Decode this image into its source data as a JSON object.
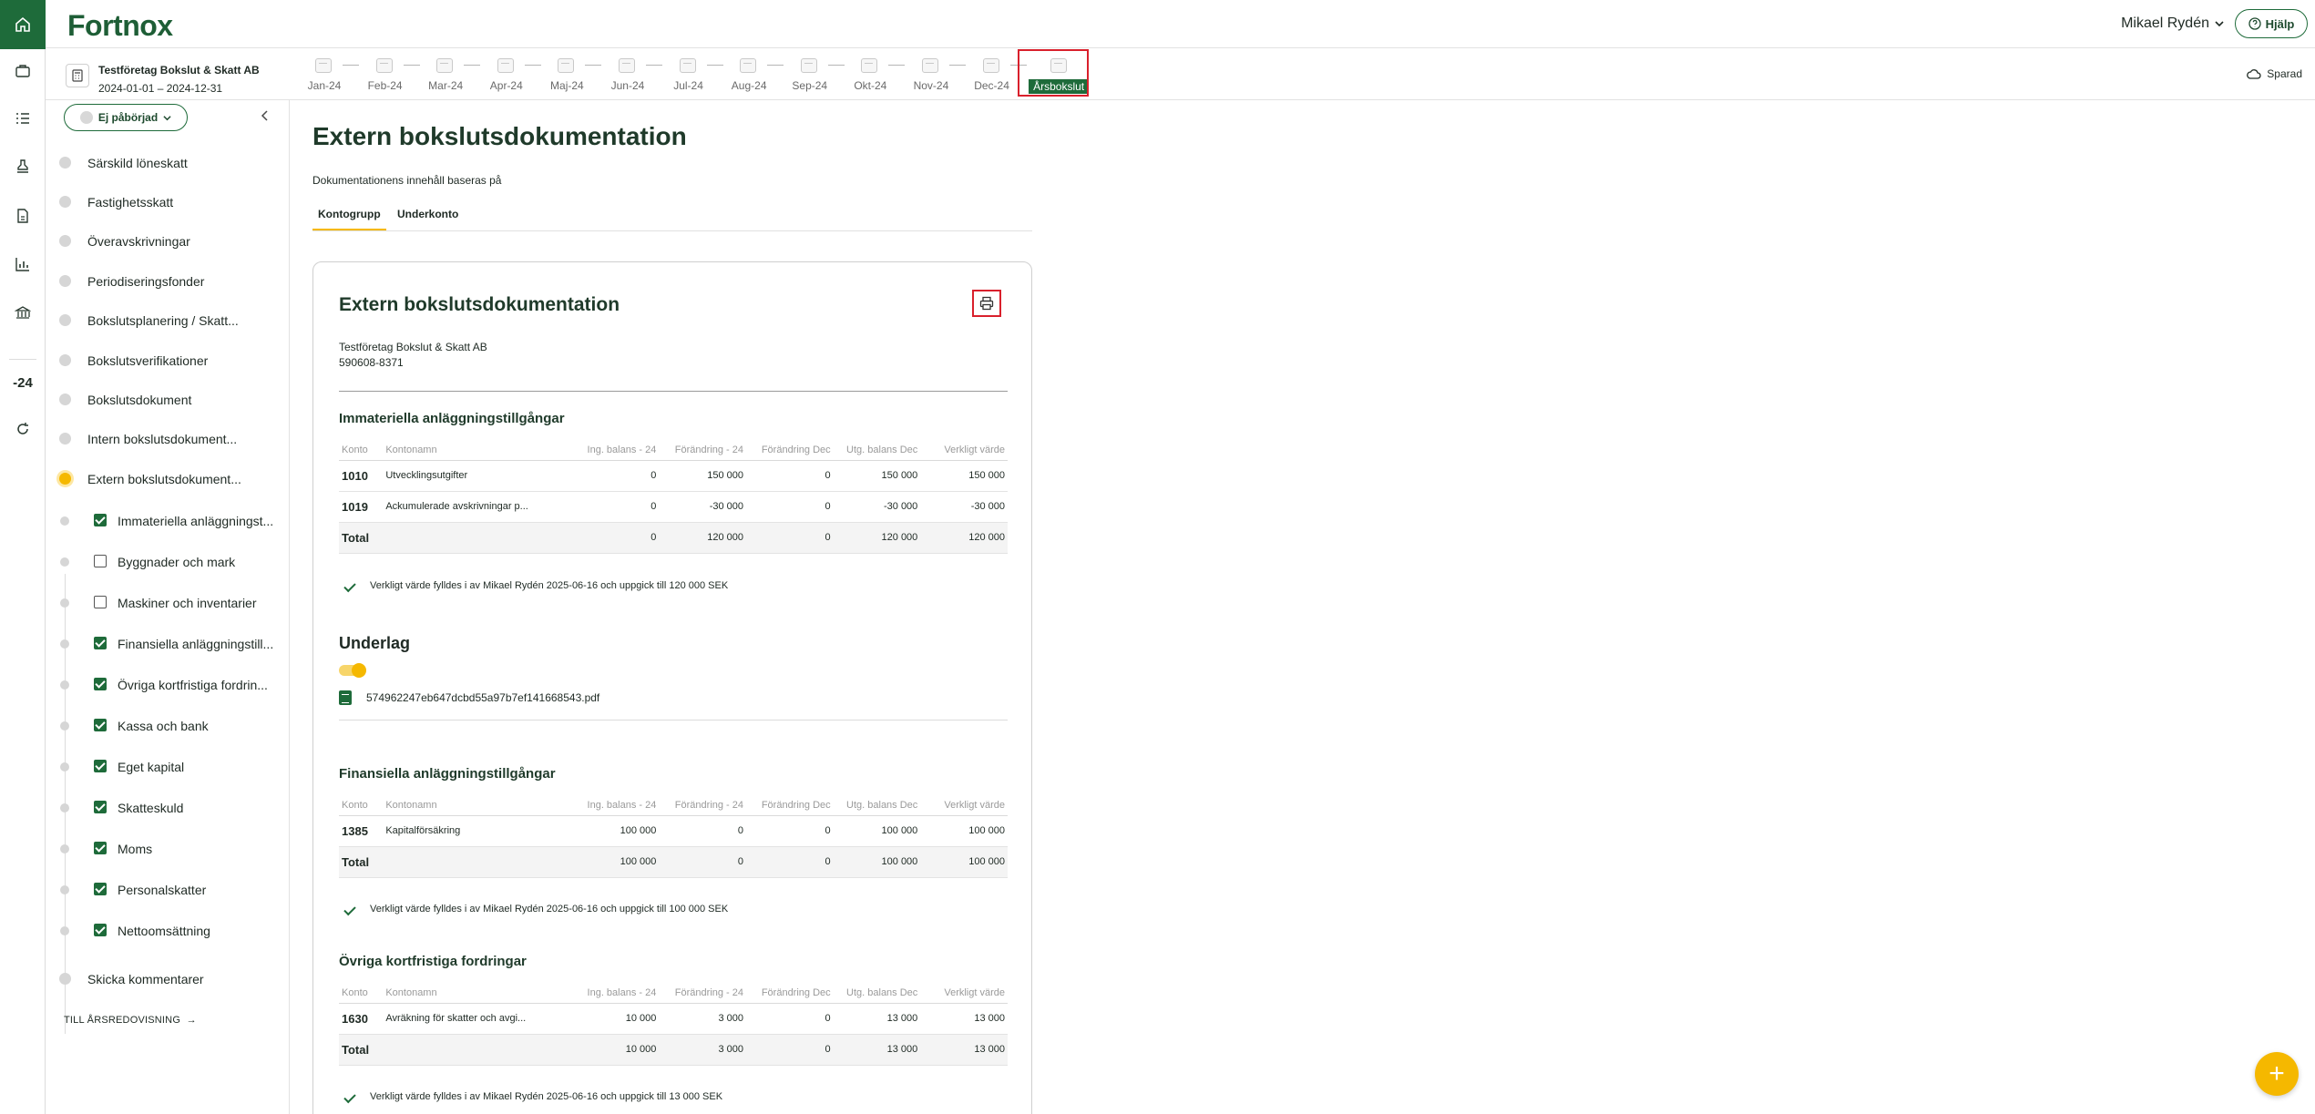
{
  "brand": "Fortnox",
  "header": {
    "user_name": "Mikael Rydén",
    "help_label": "Hjälp",
    "saved_label": "Sparad"
  },
  "rail": {
    "year_label": "-24"
  },
  "company": {
    "name": "Testföretag Bokslut & Skatt AB",
    "period": "2024-01-01 – 2024-12-31"
  },
  "months": [
    "Jan-24",
    "Feb-24",
    "Mar-24",
    "Apr-24",
    "Maj-24",
    "Jun-24",
    "Jul-24",
    "Aug-24",
    "Sep-24",
    "Okt-24",
    "Nov-24",
    "Dec-24",
    "Årsbokslut"
  ],
  "sidebar": {
    "status": "Ej påbörjad",
    "items": [
      "Särskild löneskatt",
      "Fastighetsskatt",
      "Överavskrivningar",
      "Periodiseringsfonder",
      "Bokslutsplanering / Skatt...",
      "Bokslutsverifikationer",
      "Bokslutsdokument",
      "Intern bokslutsdokument...",
      "Extern bokslutsdokument..."
    ],
    "subitems": [
      {
        "label": "Immateriella anläggningst...",
        "checked": true
      },
      {
        "label": "Byggnader och mark",
        "checked": false
      },
      {
        "label": "Maskiner och inventarier",
        "checked": false
      },
      {
        "label": "Finansiella anläggningstill...",
        "checked": true
      },
      {
        "label": "Övriga kortfristiga fordrin...",
        "checked": true
      },
      {
        "label": "Kassa och bank",
        "checked": true
      },
      {
        "label": "Eget kapital",
        "checked": true
      },
      {
        "label": "Skatteskuld",
        "checked": true
      },
      {
        "label": "Moms",
        "checked": true
      },
      {
        "label": "Personalskatter",
        "checked": true
      },
      {
        "label": "Nettoomsättning",
        "checked": true
      }
    ],
    "last_item": "Skicka kommentarer",
    "to_report": "TILL ÅRSREDOVISNING"
  },
  "main": {
    "title": "Extern bokslutsdokumentation",
    "based_on": "Dokumentationens innehåll baseras på",
    "tabs": [
      "Kontogrupp",
      "Underkonto"
    ],
    "card": {
      "title": "Extern bokslutsdokumentation",
      "company": "Testföretag Bokslut & Skatt AB",
      "org_no": "590608-8371",
      "columns": [
        "Konto",
        "Kontonamn",
        "Ing. balans - 24",
        "Förändring - 24",
        "Förändring Dec",
        "Utg. balans Dec",
        "Verkligt värde"
      ],
      "sections": [
        {
          "title": "Immateriella anläggningstillgångar",
          "rows": [
            [
              "1010",
              "Utvecklingsutgifter",
              "0",
              "150 000",
              "0",
              "150 000",
              "150 000"
            ],
            [
              "1019",
              "Ackumulerade avskrivningar p...",
              "0",
              "-30 000",
              "0",
              "-30 000",
              "-30 000"
            ],
            [
              "Total",
              "",
              "0",
              "120 000",
              "0",
              "120 000",
              "120 000"
            ]
          ],
          "note": "Verkligt värde fylldes i av Mikael Rydén 2025-06-16 och uppgick till 120 000 SEK"
        },
        {
          "title": "Finansiella anläggningstillgångar",
          "rows": [
            [
              "1385",
              "Kapitalförsäkring",
              "100 000",
              "0",
              "0",
              "100 000",
              "100 000"
            ],
            [
              "Total",
              "",
              "100 000",
              "0",
              "0",
              "100 000",
              "100 000"
            ]
          ],
          "note": "Verkligt värde fylldes i av Mikael Rydén 2025-06-16 och uppgick till 100 000 SEK"
        },
        {
          "title": "Övriga kortfristiga fordringar",
          "rows": [
            [
              "1630",
              "Avräkning för skatter och avgi...",
              "10 000",
              "3 000",
              "0",
              "13 000",
              "13 000"
            ],
            [
              "Total",
              "",
              "10 000",
              "3 000",
              "0",
              "13 000",
              "13 000"
            ]
          ],
          "note": "Verkligt värde fylldes i av Mikael Rydén 2025-06-16 och uppgick till 13 000 SEK"
        }
      ],
      "underlag_title": "Underlag",
      "file_name": "574962247eb647dcbd55a97b7ef141668543.pdf"
    }
  },
  "fab_label": "+"
}
